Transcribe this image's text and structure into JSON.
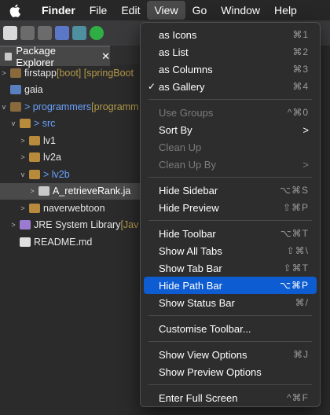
{
  "menubar": {
    "items": [
      "Finder",
      "File",
      "Edit",
      "View",
      "Go",
      "Window",
      "Help"
    ],
    "active": "View"
  },
  "panel": {
    "title": "Package Explorer",
    "close": "✕"
  },
  "tree": [
    {
      "arrow": ">",
      "name": "firstapp",
      "suffix": " [boot] [springBoot"
    },
    {
      "arrow": "",
      "name": "gaia",
      "suffix": ""
    },
    {
      "arrow": "v",
      "name": "> programmers",
      "suffix": " [programm"
    },
    {
      "arrow": "v",
      "name": "> src",
      "suffix": ""
    },
    {
      "arrow": ">",
      "name": "lv1",
      "suffix": ""
    },
    {
      "arrow": ">",
      "name": "lv2a",
      "suffix": ""
    },
    {
      "arrow": "v",
      "name": "> lv2b",
      "suffix": ""
    },
    {
      "arrow": ">",
      "name": "A_retrieveRank.ja",
      "suffix": ""
    },
    {
      "arrow": ">",
      "name": "naverwebtoon",
      "suffix": ""
    },
    {
      "arrow": ">",
      "name": "JRE System Library",
      "suffix": " [Jav"
    },
    {
      "arrow": "",
      "name": "README.md",
      "suffix": ""
    }
  ],
  "menu": {
    "group1": [
      {
        "label": "as Icons",
        "shortcut": "⌘1"
      },
      {
        "label": "as List",
        "shortcut": "⌘2"
      },
      {
        "label": "as Columns",
        "shortcut": "⌘3"
      },
      {
        "label": "as Gallery",
        "shortcut": "⌘4",
        "checked": "✓"
      }
    ],
    "group2": [
      {
        "label": "Use Groups",
        "shortcut": "^⌘0"
      },
      {
        "label": "Sort By",
        "chevron": ">"
      },
      {
        "label": "Clean Up",
        "shortcut": ""
      },
      {
        "label": "Clean Up By",
        "chevron": ">"
      }
    ],
    "group3": [
      {
        "label": "Hide Sidebar",
        "shortcut": "⌥⌘S"
      },
      {
        "label": "Hide Preview",
        "shortcut": "⇧⌘P"
      }
    ],
    "group4": [
      {
        "label": "Hide Toolbar",
        "shortcut": "⌥⌘T"
      },
      {
        "label": "Show All Tabs",
        "shortcut": "⇧⌘\\"
      },
      {
        "label": "Show Tab Bar",
        "shortcut": "⇧⌘T"
      },
      {
        "label": "Hide Path Bar",
        "shortcut": "⌥⌘P"
      },
      {
        "label": "Show Status Bar",
        "shortcut": "⌘/"
      }
    ],
    "group5": [
      {
        "label": "Customise Toolbar..."
      }
    ],
    "group6": [
      {
        "label": "Show View Options",
        "shortcut": "⌘J"
      },
      {
        "label": "Show Preview Options",
        "shortcut": ""
      }
    ],
    "group7": [
      {
        "label": "Enter Full Screen",
        "shortcut": "^⌘F"
      }
    ]
  }
}
